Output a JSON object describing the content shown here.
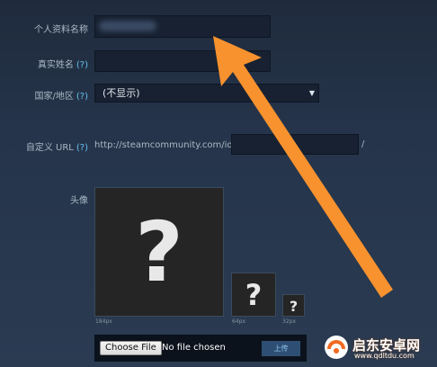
{
  "form": {
    "profile_name_label": "个人资料名称",
    "real_name_label": "真实姓名",
    "country_label": "国家/地区",
    "country_value": "(不显示)",
    "custom_url_label": "自定义 URL",
    "custom_url_prefix": "http://steamcommunity.com/id/",
    "custom_url_suffix": "/",
    "help_text": "(?)",
    "avatar_label": "头像"
  },
  "avatar": {
    "placeholder_glyph": "?",
    "size_large": "184px",
    "size_medium": "64px",
    "size_small": "32px"
  },
  "upload": {
    "choose_file_label": "Choose File",
    "no_file_text": "No file chosen",
    "upload_button_label": "上传"
  },
  "watermark": {
    "title": "启东安卓网",
    "url": "www.qdltdu.com"
  },
  "colors": {
    "background": "#243247",
    "help_link": "#66c0f4",
    "arrow": "#f7922e"
  }
}
